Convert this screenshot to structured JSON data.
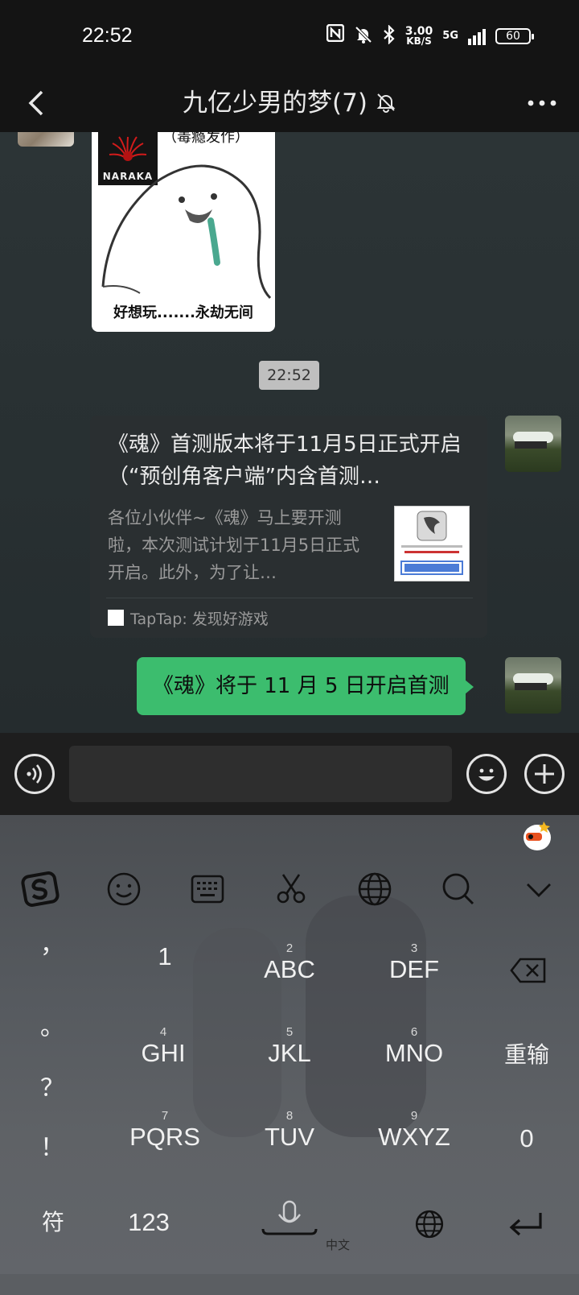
{
  "status_bar": {
    "time": "22:52",
    "net_speed_value": "3.00",
    "net_speed_unit": "KB/S",
    "network": "5G",
    "battery": "60"
  },
  "header": {
    "title": "九亿少男的梦(7)",
    "back_icon": "chevron-left-icon",
    "mute_icon": "bell-off-icon",
    "more_icon": "more-dots-icon"
  },
  "messages": {
    "sticker": {
      "top_text": "（毒瘾发作）",
      "logo_text": "NARAKA",
      "caption": "好想玩.......永劫无间"
    },
    "timestamp": "22:52",
    "link_card": {
      "title": "《魂》首测版本将于11月5日正式开启（“预创角客户端”内含首测…",
      "description": "各位小伙伴~《魂》马上要开测啦，本次测试计划于11月5日正式开启。此外，为了让…",
      "source": "TapTap: 发现好游戏"
    },
    "text_message": "《魂》将于 11 月 5 日开启首测"
  },
  "input_bar": {
    "voice_icon": "voice-icon",
    "emoji_icon": "emoji-icon",
    "plus_icon": "plus-icon",
    "input_value": ""
  },
  "keyboard": {
    "toolbar": [
      "sogou-logo-icon",
      "emoji-icon",
      "keyboard-icon",
      "scissors-icon",
      "globe-icon",
      "search-icon",
      "chevron-down-icon"
    ],
    "punctuation": [
      "，",
      "。",
      "？",
      "！"
    ],
    "keys": {
      "k1": {
        "label": "1"
      },
      "k2": {
        "num": "2",
        "label": "ABC"
      },
      "k3": {
        "num": "3",
        "label": "DEF"
      },
      "k4": {
        "num": "4",
        "label": "GHI"
      },
      "k5": {
        "num": "5",
        "label": "JKL"
      },
      "k6": {
        "num": "6",
        "label": "MNO"
      },
      "k7": {
        "num": "7",
        "label": "PQRS"
      },
      "k8": {
        "num": "8",
        "label": "TUV"
      },
      "k9": {
        "num": "9",
        "label": "WXYZ"
      },
      "k0": {
        "label": "0"
      }
    },
    "retype": "重输",
    "symbols": "符",
    "numeric": "123",
    "space_label": "中文",
    "backspace_icon": "backspace-icon",
    "enter_icon": "enter-icon"
  }
}
